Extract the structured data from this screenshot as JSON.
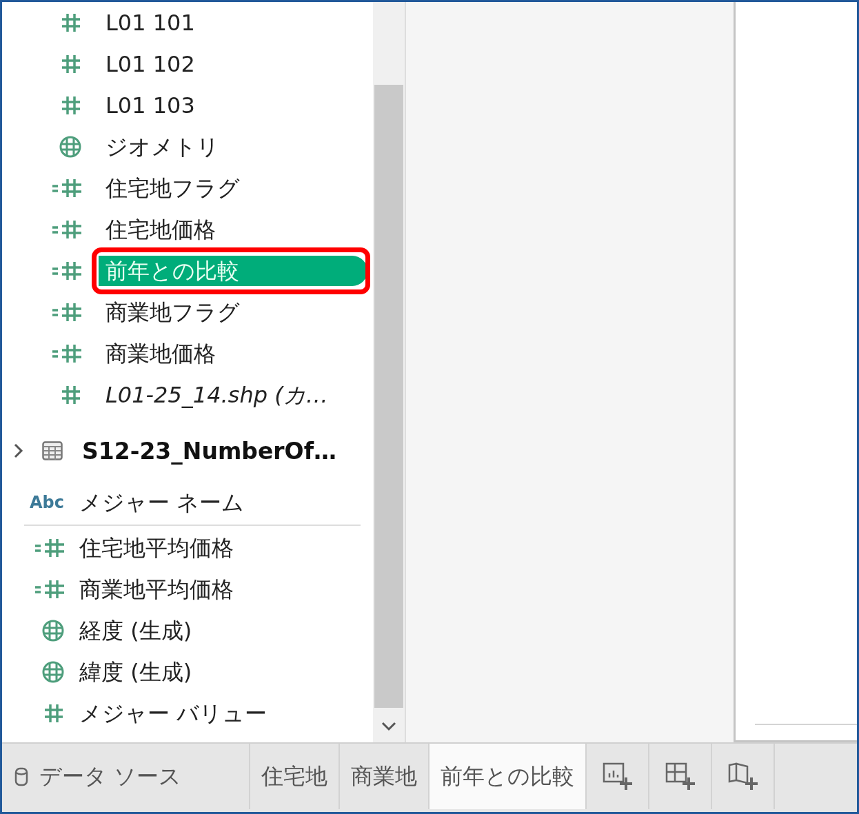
{
  "upper_fields": [
    {
      "kind": "measure",
      "label": "L01 101",
      "italic": false,
      "selected": false,
      "outlined": false
    },
    {
      "kind": "measure",
      "label": "L01 102",
      "italic": false,
      "selected": false,
      "outlined": false
    },
    {
      "kind": "measure",
      "label": "L01 103",
      "italic": false,
      "selected": false,
      "outlined": false
    },
    {
      "kind": "geo",
      "label": "ジオメトリ",
      "italic": false,
      "selected": false,
      "outlined": false
    },
    {
      "kind": "calc",
      "label": "住宅地フラグ",
      "italic": false,
      "selected": false,
      "outlined": false
    },
    {
      "kind": "calc",
      "label": "住宅地価格",
      "italic": false,
      "selected": false,
      "outlined": false
    },
    {
      "kind": "calc",
      "label": "前年との比較",
      "italic": false,
      "selected": true,
      "outlined": true
    },
    {
      "kind": "calc",
      "label": "商業地フラグ",
      "italic": false,
      "selected": false,
      "outlined": false
    },
    {
      "kind": "calc",
      "label": "商業地価格",
      "italic": false,
      "selected": false,
      "outlined": false
    },
    {
      "kind": "measure",
      "label": "L01-25_14.shp (カ…",
      "italic": true,
      "selected": false,
      "outlined": false
    }
  ],
  "table": {
    "label": "S12-23_NumberOf…",
    "expanded": false
  },
  "dimension_fields": [
    {
      "kind": "abc",
      "icon_text": "Abc",
      "label": "メジャー ネーム"
    }
  ],
  "measure_fields": [
    {
      "kind": "calc",
      "label": "住宅地平均価格"
    },
    {
      "kind": "calc",
      "label": "商業地平均価格"
    },
    {
      "kind": "geo",
      "label": "経度 (生成)"
    },
    {
      "kind": "geo",
      "label": "緯度 (生成)"
    },
    {
      "kind": "measure",
      "label": "メジャー バリュー"
    }
  ],
  "bottom_tabs": {
    "data_source": "データ ソース",
    "sheets": [
      {
        "label": "住宅地",
        "selected": false
      },
      {
        "label": "商業地",
        "selected": false
      },
      {
        "label": "前年との比較",
        "selected": true
      }
    ],
    "new_buttons": [
      {
        "kind": "worksheet"
      },
      {
        "kind": "dashboard"
      },
      {
        "kind": "story"
      }
    ]
  }
}
